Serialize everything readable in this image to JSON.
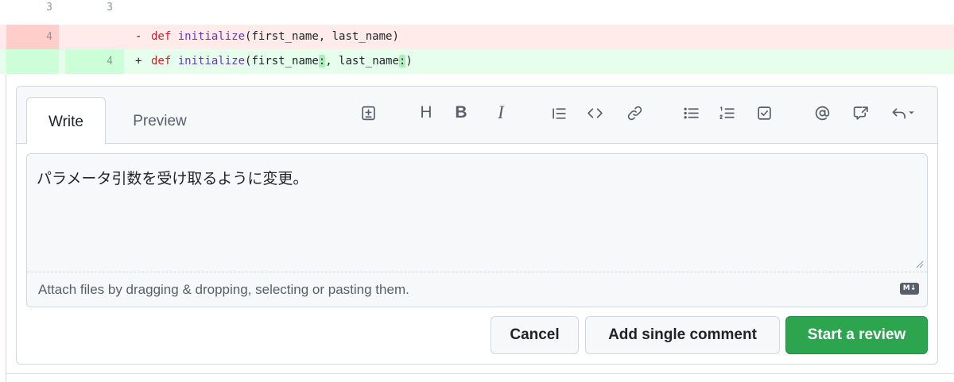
{
  "diff": {
    "context_row": {
      "old_line": "3",
      "new_line": "3"
    },
    "deleted_row": {
      "old_line": "4",
      "sign": "-",
      "keyword": "def",
      "func": "initialize",
      "args_a": "(first_name, last_name)"
    },
    "added_row": {
      "new_line": "4",
      "sign": "+",
      "keyword": "def",
      "func": "initialize",
      "p1": "(first_name",
      "c1": ":",
      "p2": ", last_name",
      "c2": ":",
      "p3": ")"
    }
  },
  "comment_box": {
    "tabs": {
      "write": "Write",
      "preview": "Preview"
    },
    "toolbar": {
      "heading": "H",
      "bold": "B",
      "italic": "I",
      "icons": [
        "insert-suggestion-icon",
        "heading-icon",
        "bold-icon",
        "italic-icon",
        "quote-icon",
        "code-icon",
        "link-icon",
        "unordered-list-icon",
        "ordered-list-icon",
        "task-list-icon",
        "mention-icon",
        "cross-reference-icon",
        "reply-icon"
      ]
    },
    "text_value": "パラメータ引数を受け取るように変更。",
    "attach_hint": "Attach files by dragging & dropping, selecting or pasting them.",
    "markdown_badge": "M↓"
  },
  "buttons": {
    "cancel": "Cancel",
    "add_single": "Add single comment",
    "start_review": "Start a review"
  },
  "colors": {
    "deleted_bg": "#ffebe9",
    "added_bg": "#e6ffec",
    "primary": "#2da44e"
  }
}
